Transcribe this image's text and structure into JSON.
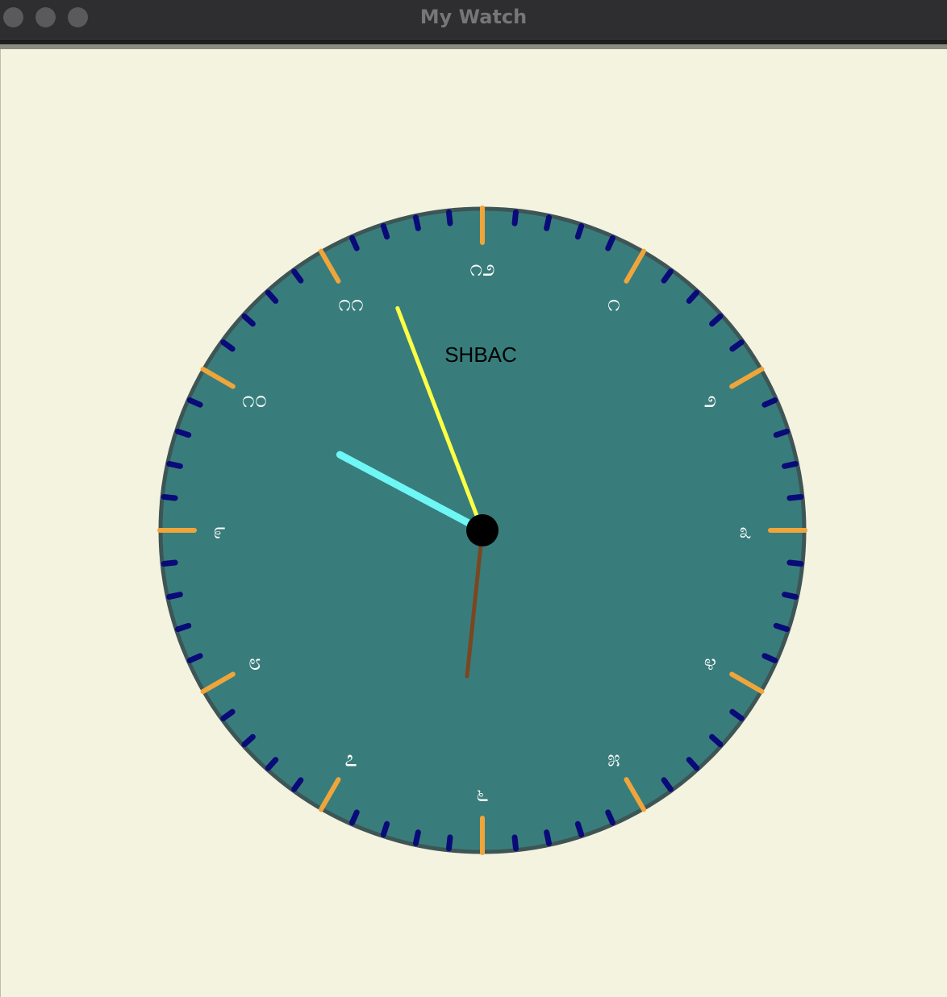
{
  "window": {
    "title": "My Watch",
    "buttons": [
      "close",
      "minimize",
      "zoom"
    ]
  },
  "clock": {
    "brand": "SHBAC",
    "numerals": [
      "೧೨",
      "೧",
      "೨",
      "೩",
      "೪",
      "೫",
      "೬",
      "೭",
      "೮",
      "೯",
      "೧೦",
      "೧೧"
    ],
    "time": {
      "hour": 9,
      "minute": 56,
      "second": 31
    },
    "colors": {
      "background": "#f4f3e0",
      "face": "#387d7c",
      "rim": "#3e5555",
      "major_tick": "#f0a53a",
      "minor_tick": "#0a0a78",
      "hour_hand": "#6ef7f5",
      "minute_hand": "#ffff44",
      "second_hand": "#7a4720",
      "hub": "#000000",
      "numeral": "#ffffff"
    }
  }
}
